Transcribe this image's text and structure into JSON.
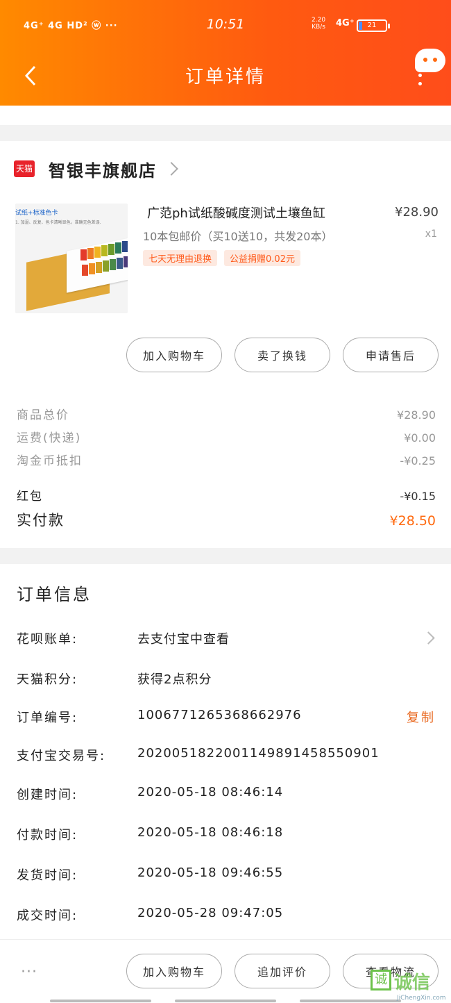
{
  "status_bar": {
    "left_icons": "4G⁺ 4G HD² ⓦ ···",
    "time": "10:51",
    "speed_value": "2.20",
    "speed_unit": "KB/s",
    "network": "4G⁺",
    "battery": "21"
  },
  "header": {
    "title": "订单详情"
  },
  "shop": {
    "badge": "天猫",
    "name": "智银丰旗舰店"
  },
  "product": {
    "image_caption": "试纸+标准色卡",
    "image_subcaption": "1. 加湿、反复、色卡清晰显色，准确无色差误.",
    "title": "广范ph试纸酸碱度测试土壤鱼缸",
    "price": "¥28.90",
    "spec": "10本包邮价（买10送10，共发20本）",
    "quantity": "x1",
    "tags": [
      "七天无理由退换",
      "公益捐赠0.02元"
    ]
  },
  "action_buttons": [
    "加入购物车",
    "卖了换钱",
    "申请售后"
  ],
  "summary": [
    {
      "label": "商品总价",
      "value": "¥28.90"
    },
    {
      "label": "运费(快递)",
      "value": "¥0.00"
    },
    {
      "label": "淘金币抵扣",
      "value": "-¥0.25"
    }
  ],
  "red_packet": {
    "label": "红包",
    "value": "-¥0.15"
  },
  "paid": {
    "label": "实付款",
    "value": "¥28.50"
  },
  "order_info": {
    "title": "订单信息",
    "rows": [
      {
        "label": "花呗账单:",
        "value": "去支付宝中查看"
      },
      {
        "label": "天猫积分:",
        "value": "获得2点积分"
      },
      {
        "label": "订单编号:",
        "value": "1006771265368662976"
      },
      {
        "label": "支付宝交易号:",
        "value": "2020051822001149891458550901"
      },
      {
        "label": "创建时间:",
        "value": "2020-05-18  08:46:14"
      },
      {
        "label": "付款时间:",
        "value": "2020-05-18  08:46:18"
      },
      {
        "label": "发货时间:",
        "value": "2020-05-18  09:46:55"
      },
      {
        "label": "成交时间:",
        "value": "2020-05-28  09:47:05"
      }
    ],
    "copy_label": "复制"
  },
  "bottom_bar": {
    "more": "···",
    "buttons": [
      "加入购物车",
      "追加评价",
      "查看物流"
    ]
  },
  "watermark": {
    "logo": "诚",
    "text": "诚信",
    "sub": "JiChengXin.com"
  }
}
